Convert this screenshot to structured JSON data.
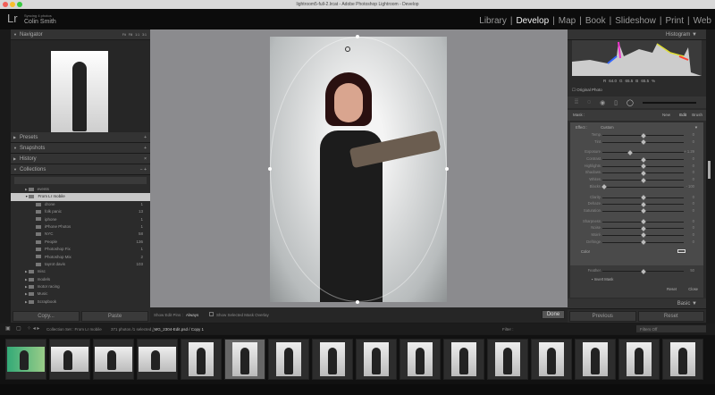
{
  "window": {
    "title": "lightroom5-full-2.lrcat - Adobe Photoshop Lightroom - Develop"
  },
  "identity": {
    "logo": "Lr",
    "sync_status": "Syncing 4 photos",
    "user": "Colin Smith"
  },
  "modules": [
    {
      "label": "Library"
    },
    {
      "label": "Develop",
      "active": true
    },
    {
      "label": "Map"
    },
    {
      "label": "Book"
    },
    {
      "label": "Slideshow"
    },
    {
      "label": "Print"
    },
    {
      "label": "Web"
    }
  ],
  "left": {
    "navigator": "Navigator",
    "nav_zoom": [
      "Fit",
      "Fill",
      "1:1",
      "3:1"
    ],
    "presets": "Presets",
    "snapshots": "Snapshots",
    "history": "History",
    "collections": "Collections",
    "collection_items": [
      {
        "label": "events",
        "level": 1
      },
      {
        "label": "From Lr mobile",
        "level": 1,
        "selected": true
      },
      {
        "label": "drone",
        "level": 2,
        "count": "1"
      },
      {
        "label": "folk panic",
        "level": 2,
        "count": "13"
      },
      {
        "label": "iphone",
        "level": 2,
        "count": "1"
      },
      {
        "label": "iPhone Photos",
        "level": 2,
        "count": "1"
      },
      {
        "label": "NYC",
        "level": 2,
        "count": "58"
      },
      {
        "label": "People",
        "level": 2,
        "count": "136"
      },
      {
        "label": "Photoshop Fix",
        "level": 2,
        "count": "1"
      },
      {
        "label": "Photoshop Mix",
        "level": 2,
        "count": "2"
      },
      {
        "label": "tayrot davis",
        "level": 2,
        "count": "103"
      },
      {
        "label": "misc",
        "level": 1
      },
      {
        "label": "models",
        "level": 1
      },
      {
        "label": "motor racing",
        "level": 1
      },
      {
        "label": "Music",
        "level": 1
      },
      {
        "label": "Scrapbook",
        "level": 1
      }
    ],
    "copy": "Copy...",
    "paste": "Paste"
  },
  "toolbar": {
    "show_edit_pins_label": "Show Edit Pins :",
    "show_edit_pins_value": "Always",
    "overlay_label": "Show Selected Mask Overlay",
    "done": "Done"
  },
  "right": {
    "histogram": "Histogram",
    "rgb": {
      "r_label": "R",
      "r": "64.0",
      "g_label": "G",
      "g": "65.5",
      "b_label": "B",
      "b": "65.5",
      "unit": "%"
    },
    "original_photo": "Original Photo",
    "mask_label": "Mask :",
    "mask_modes": [
      "New",
      "Edit",
      "Brush"
    ],
    "effect_label": "Effect :",
    "effect_value": "Custom",
    "sliders": [
      {
        "label": "Temp",
        "value": "0",
        "pos": 0.5
      },
      {
        "label": "Tint",
        "value": "0",
        "pos": 0.5
      },
      {
        "label": "Exposure",
        "value": "+ 1.29",
        "pos": 0.33,
        "gap": true
      },
      {
        "label": "Contrast",
        "value": "0",
        "pos": 0.5
      },
      {
        "label": "Highlights",
        "value": "0",
        "pos": 0.5
      },
      {
        "label": "Shadows",
        "value": "0",
        "pos": 0.5
      },
      {
        "label": "Whites",
        "value": "0",
        "pos": 0.5
      },
      {
        "label": "Blacks",
        "value": "- 100",
        "pos": 0
      },
      {
        "label": "Clarity",
        "value": "0",
        "pos": 0.5,
        "gap": true
      },
      {
        "label": "Dehaze",
        "value": "0",
        "pos": 0.5
      },
      {
        "label": "Saturation",
        "value": "0",
        "pos": 0.5
      },
      {
        "label": "Sharpness",
        "value": "0",
        "pos": 0.5,
        "gap": true
      },
      {
        "label": "Noise",
        "value": "0",
        "pos": 0.5
      },
      {
        "label": "Moiré",
        "value": "0",
        "pos": 0.5
      },
      {
        "label": "Defringe",
        "value": "0",
        "pos": 0.5
      }
    ],
    "color_label": "Color",
    "feather_label": "Feather",
    "feather_value": "50",
    "feather_pos": 0.5,
    "invert_mask": "Invert Mask",
    "reset": "Reset",
    "close": "Close",
    "basic": "Basic",
    "previous": "Previous",
    "reset_all": "Reset"
  },
  "filmstrip": {
    "source": "Collection Set : From Lr mobile",
    "count": "371 photos /1 selected /",
    "file": "_MG_2304-Edit.psd / Copy 1",
    "filter_label": "Filter :",
    "filter_value": "Filters Off",
    "selected_index": 5,
    "thumb_count": 16
  }
}
